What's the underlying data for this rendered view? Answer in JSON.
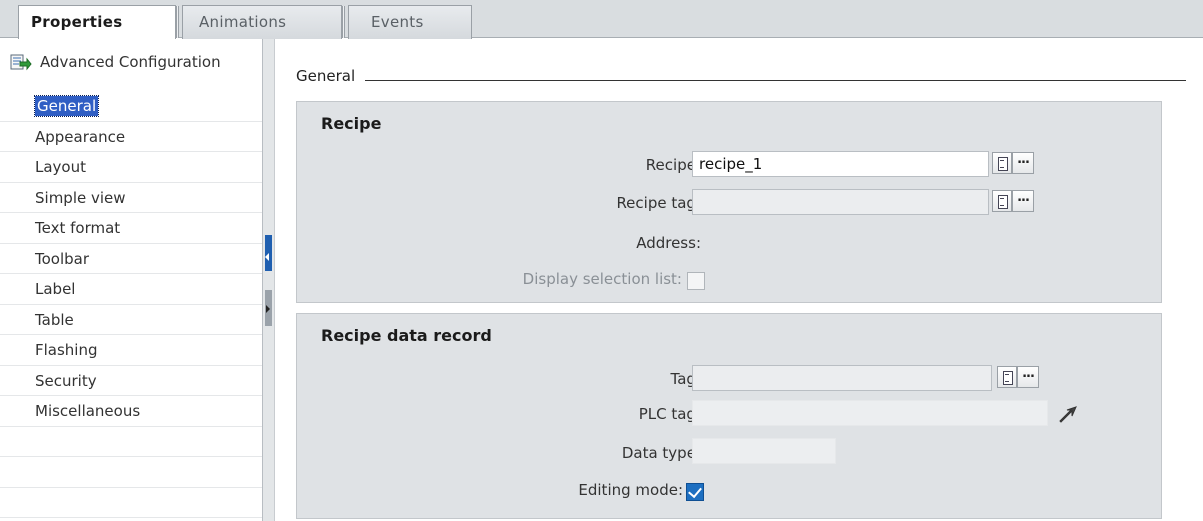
{
  "tabs": [
    {
      "label": "Properties",
      "active": true
    },
    {
      "label": "Animations",
      "active": false
    },
    {
      "label": "Events",
      "active": false
    }
  ],
  "leftnav": {
    "header": {
      "label": "Advanced Configuration",
      "icon": "advanced-config-icon"
    },
    "items": [
      {
        "label": "General",
        "selected": true
      },
      {
        "label": "Appearance"
      },
      {
        "label": "Layout"
      },
      {
        "label": "Simple view"
      },
      {
        "label": "Text format"
      },
      {
        "label": "Toolbar"
      },
      {
        "label": "Label"
      },
      {
        "label": "Table"
      },
      {
        "label": "Flashing"
      },
      {
        "label": "Security"
      },
      {
        "label": "Miscellaneous"
      }
    ]
  },
  "content": {
    "section_title": "General",
    "recipe_group": {
      "title": "Recipe",
      "recipe_label": "Recipe:",
      "recipe_value": "recipe_1",
      "recipe_tag_label": "Recipe tag:",
      "recipe_tag_value": "",
      "address_label": "Address:",
      "display_selection_label": "Display selection list:",
      "display_selection_checked": false
    },
    "record_group": {
      "title": "Recipe data record",
      "tag_label": "Tag:",
      "tag_value": "",
      "plc_tag_label": "PLC tag:",
      "plc_tag_value": "",
      "data_type_label": "Data type:",
      "data_type_value": "",
      "editing_mode_label": "Editing mode:",
      "editing_mode_checked": true
    },
    "buttons": {
      "browse_label": "..."
    }
  },
  "colors": {
    "accent": "#2f5ec4",
    "panel": "#dfe2e5",
    "checkbox": "#1d6fc1"
  }
}
